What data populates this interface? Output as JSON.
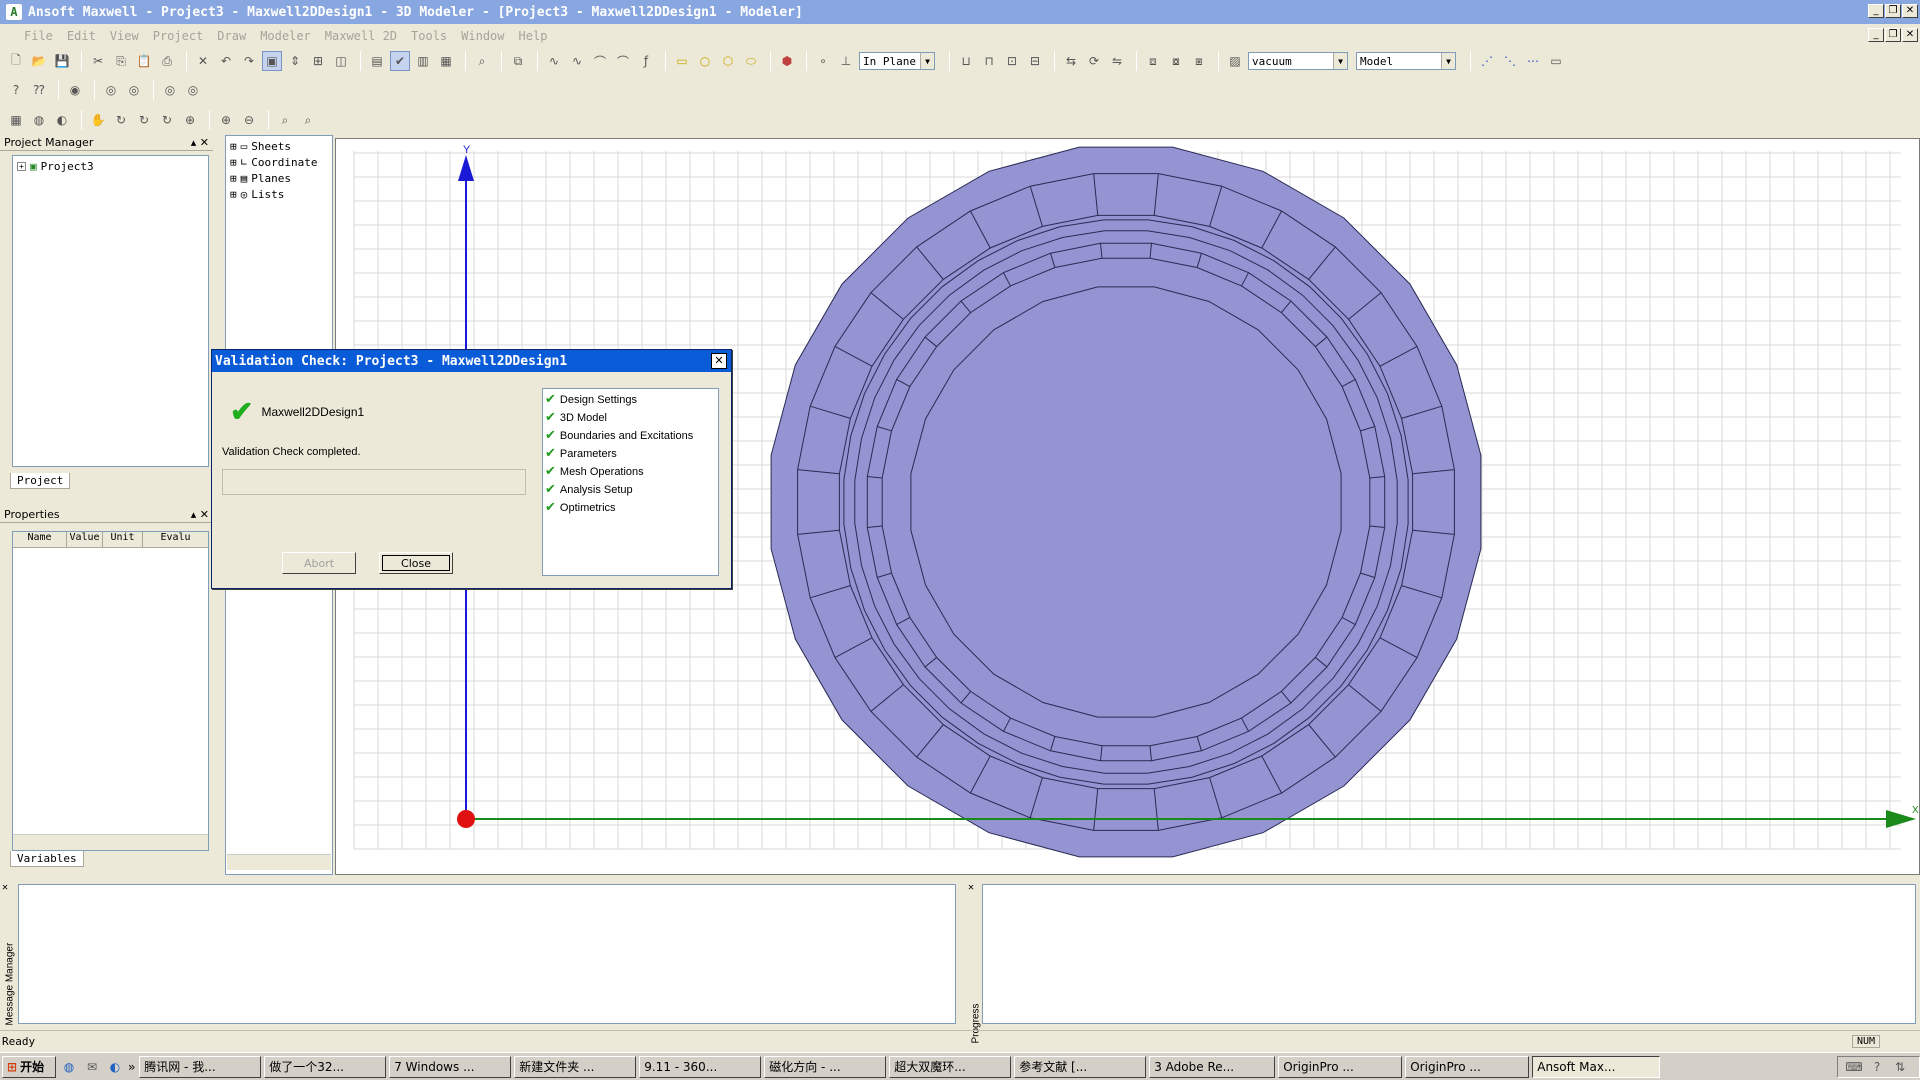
{
  "title_bar": {
    "text": "Ansoft Maxwell - Project3 - Maxwell2DDesign1 - 3D Modeler - [Project3 - Maxwell2DDesign1 - Modeler]"
  },
  "menu": [
    "File",
    "Edit",
    "View",
    "Project",
    "Draw",
    "Modeler",
    "Maxwell 2D",
    "Tools",
    "Window",
    "Help"
  ],
  "toolbar": {
    "plane_combo": "In Plane",
    "material_combo": "vacuum",
    "model_combo": "Model"
  },
  "project_manager": {
    "title": "Project Manager",
    "root": "Project3",
    "tab": "Project"
  },
  "model_tree": [
    "Sheets",
    "Coordinate",
    "Planes",
    "Lists"
  ],
  "properties": {
    "title": "Properties",
    "columns": [
      "Name",
      "Value",
      "Unit",
      "Evalu"
    ],
    "tab": "Variables"
  },
  "axes": {
    "y_label": "Y",
    "x_label": "X"
  },
  "colors": {
    "title_bar": "#88a6e0",
    "dialog_title": "#0a5bd8",
    "model_fill": "#9494d2",
    "model_stroke": "#2a2a55",
    "y_axis": "#1a1ad6",
    "x_axis": "#1a8a1a",
    "origin": "#e01010"
  },
  "dialog": {
    "title": "Validation Check: Project3 - Maxwell2DDesign1",
    "design_name": "Maxwell2DDesign1",
    "status": "Validation Check completed.",
    "abort_label": "Abort",
    "close_label": "Close",
    "checks": [
      "Design Settings",
      "3D Model",
      "Boundaries and Excitations",
      "Parameters",
      "Mesh Operations",
      "Analysis Setup",
      "Optimetrics"
    ]
  },
  "bottom": {
    "message_label": "Message Manager",
    "progress_label": "Progress"
  },
  "status_bar": {
    "text": "Ready",
    "num": "NUM"
  },
  "taskbar": {
    "start": "开始",
    "items": [
      "腾讯网 - 我...",
      "做了一个32...",
      "7 Windows ...",
      "新建文件夹 ...",
      "9.11 - 360...",
      "磁化方向 - ...",
      "超大双魔环...",
      "参考文献 [...",
      "3 Adobe Re...",
      "OriginPro ...",
      "OriginPro ...",
      "Ansoft Max..."
    ]
  }
}
